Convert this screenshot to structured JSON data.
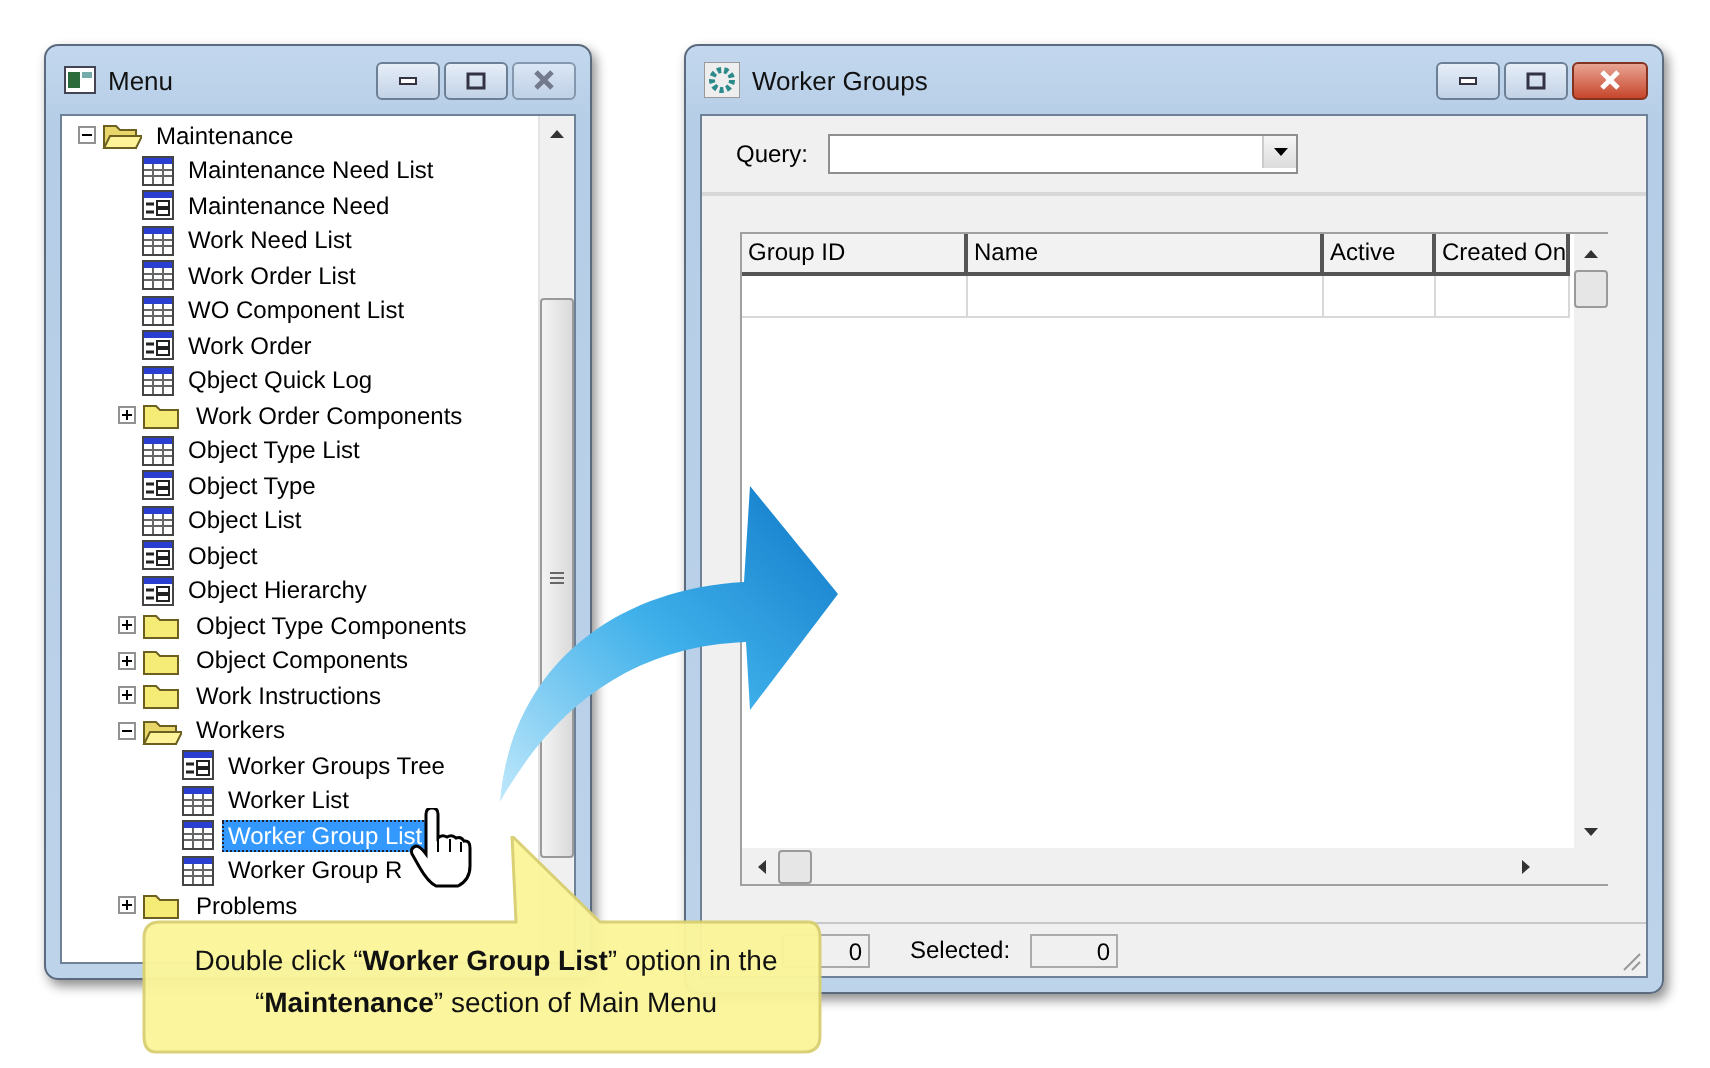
{
  "menu_window": {
    "title": "Menu",
    "tree": [
      {
        "label": "Maintenance",
        "kind": "folder",
        "expanded": true,
        "selected": false,
        "children": [
          {
            "label": "Maintenance Need List",
            "kind": "list",
            "selected": false
          },
          {
            "label": "Maintenance Need",
            "kind": "form",
            "selected": false
          },
          {
            "label": "Work Need List",
            "kind": "list",
            "selected": false
          },
          {
            "label": "Work Order List",
            "kind": "list",
            "selected": false
          },
          {
            "label": "WO Component List",
            "kind": "list",
            "selected": false
          },
          {
            "label": "Work Order",
            "kind": "form",
            "selected": false
          },
          {
            "label": "Qbject Quick Log",
            "kind": "list",
            "selected": false
          },
          {
            "label": "Work Order Components",
            "kind": "folder",
            "expanded": false,
            "selected": false
          },
          {
            "label": "Object Type List",
            "kind": "list",
            "selected": false
          },
          {
            "label": "Object Type",
            "kind": "form",
            "selected": false
          },
          {
            "label": "Object List",
            "kind": "list",
            "selected": false
          },
          {
            "label": "Object",
            "kind": "form",
            "selected": false
          },
          {
            "label": "Object Hierarchy",
            "kind": "form",
            "selected": false
          },
          {
            "label": "Object Type Components",
            "kind": "folder",
            "expanded": false,
            "selected": false
          },
          {
            "label": "Object Components",
            "kind": "folder",
            "expanded": false,
            "selected": false
          },
          {
            "label": "Work Instructions",
            "kind": "folder",
            "expanded": false,
            "selected": false
          },
          {
            "label": "Workers",
            "kind": "folder",
            "expanded": true,
            "selected": false,
            "children": [
              {
                "label": "Worker Groups Tree",
                "kind": "form",
                "selected": false
              },
              {
                "label": "Worker List",
                "kind": "list",
                "selected": false
              },
              {
                "label": "Worker Group List",
                "kind": "list",
                "selected": true
              },
              {
                "label": "Worker Group R",
                "kind": "list",
                "selected": false
              }
            ]
          },
          {
            "label": "Problems",
            "kind": "folder",
            "expanded": false,
            "selected": false
          }
        ]
      }
    ]
  },
  "worker_groups_window": {
    "title": "Worker Groups",
    "query": {
      "label": "Query:"
    },
    "grid": {
      "columns": [
        "Group ID",
        "Name",
        "Active",
        "Created On"
      ]
    },
    "status_bar": {
      "count": "0",
      "selected_label": "Selected:",
      "selected_count": "0"
    }
  },
  "callout": {
    "text": "Double click “**Worker Group List**” option in the “**Maintenance**” section of Main Menu"
  }
}
